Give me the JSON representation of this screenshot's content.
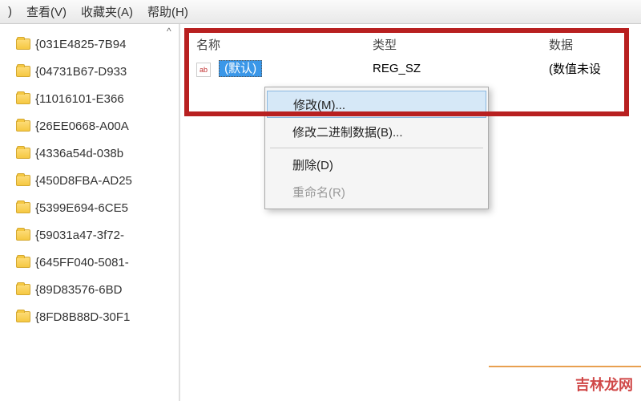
{
  "menubar": {
    "view": "查看(V)",
    "favorites": "收藏夹(A)",
    "help": "帮助(H)",
    "close_paren": ")"
  },
  "tree": {
    "items": [
      "{031E4825-7B94",
      "{04731B67-D933",
      "{11016101-E366",
      "{26EE0668-A00A",
      "{4336a54d-038b",
      "{450D8FBA-AD25",
      "{5399E694-6CE5",
      "{59031a47-3f72-",
      "{645FF040-5081-",
      "{89D83576-6BD",
      "{8FD8B88D-30F1"
    ]
  },
  "list": {
    "header": {
      "name": "名称",
      "type": "类型",
      "data": "数据"
    },
    "row": {
      "icon_label": "ab",
      "name": "(默认)",
      "type": "REG_SZ",
      "data": "(数值未设"
    }
  },
  "context_menu": {
    "modify": "修改(M)...",
    "modify_binary": "修改二进制数据(B)...",
    "delete": "删除(D)",
    "rename": "重命名(R)"
  },
  "watermark": "吉林龙网"
}
